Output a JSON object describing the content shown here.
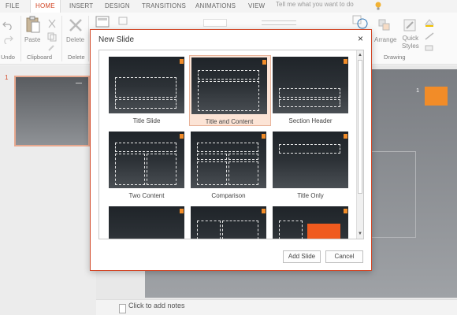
{
  "tabs": {
    "file": "FILE",
    "home": "HOME",
    "insert": "INSERT",
    "design": "DESIGN",
    "transitions": "TRANSITIONS",
    "animations": "ANIMATIONS",
    "view": "VIEW",
    "tell_me": "Tell me what you want to do"
  },
  "ribbon": {
    "undo_group": "Undo",
    "paste": "Paste",
    "clipboard_group": "Clipboard",
    "delete": "Delete",
    "delete_group": "Delete",
    "arrange": "Arrange",
    "quick_styles": "Quick\nStyles",
    "drawing_group": "Drawing"
  },
  "thumbnails": {
    "slide_number": "1"
  },
  "slide": {
    "number": "1"
  },
  "notes": {
    "placeholder": "Click to add notes"
  },
  "dialog": {
    "title": "New Slide",
    "close": "×",
    "layouts": [
      {
        "label": "Title Slide"
      },
      {
        "label": "Title and Content",
        "selected": true
      },
      {
        "label": "Section Header"
      },
      {
        "label": "Two Content"
      },
      {
        "label": "Comparison"
      },
      {
        "label": "Title Only"
      },
      {
        "label": ""
      },
      {
        "label": ""
      },
      {
        "label": ""
      }
    ],
    "add_button": "Add Slide",
    "cancel_button": "Cancel"
  },
  "colors": {
    "accent": "#d24726",
    "theme_orange": "#f28c28"
  }
}
